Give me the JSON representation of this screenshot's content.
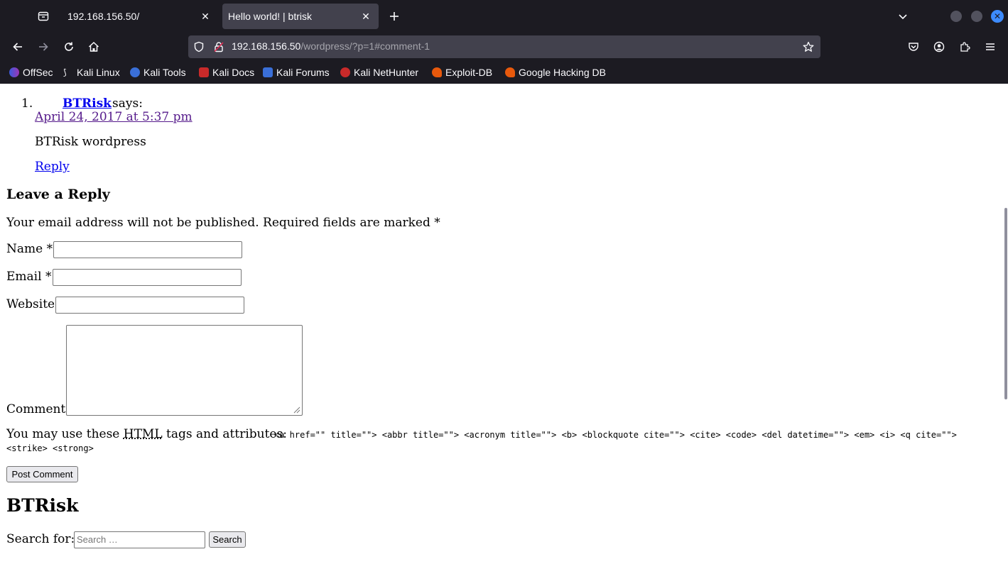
{
  "browser": {
    "tabs": [
      {
        "title": "192.168.156.50/",
        "active": false
      },
      {
        "title": "Hello world! | btrisk",
        "active": true
      }
    ],
    "url_host": "192.168.156.50",
    "url_path": "/wordpress/?p=1#comment-1",
    "bookmarks": [
      "OffSec",
      "Kali Linux",
      "Kali Tools",
      "Kali Docs",
      "Kali Forums",
      "Kali NetHunter",
      "Exploit-DB",
      "Google Hacking DB"
    ]
  },
  "comment": {
    "number": "1.",
    "author": "BTRisk",
    "says": "says:",
    "date": "April 24, 2017 at 5:37 pm",
    "text": "BTRisk wordpress",
    "reply": "Reply"
  },
  "reply_form": {
    "heading": "Leave a Reply",
    "notes": "Your email address will not be published. Required fields are marked *",
    "name_label": "Name *",
    "email_label": "Email *",
    "website_label": "Website",
    "comment_label": "Comment",
    "allowed_prefix": "You may use these",
    "allowed_abbr": "HTML",
    "allowed_suffix": "tags and attributes:",
    "allowed_tags_line1": "<a href=\"\" title=\"\"> <abbr title=\"\"> <acronym title=\"\"> <b> <blockquote cite=\"\"> <cite> <code> <del datetime=\"\"> <em> <i> <q cite=\"\">",
    "allowed_tags_line2": "<strike> <strong>",
    "submit": "Post Comment"
  },
  "sidebar": {
    "site_title": "BTRisk",
    "search_label": "Search for:",
    "search_placeholder": "Search …",
    "search_button": "Search"
  },
  "colors": {
    "chrome_bg": "#1c1b22",
    "url_bg": "#42414d",
    "link": "#0000ee",
    "visited_link": "#551a8b",
    "close_button": "#3d8bfd"
  }
}
